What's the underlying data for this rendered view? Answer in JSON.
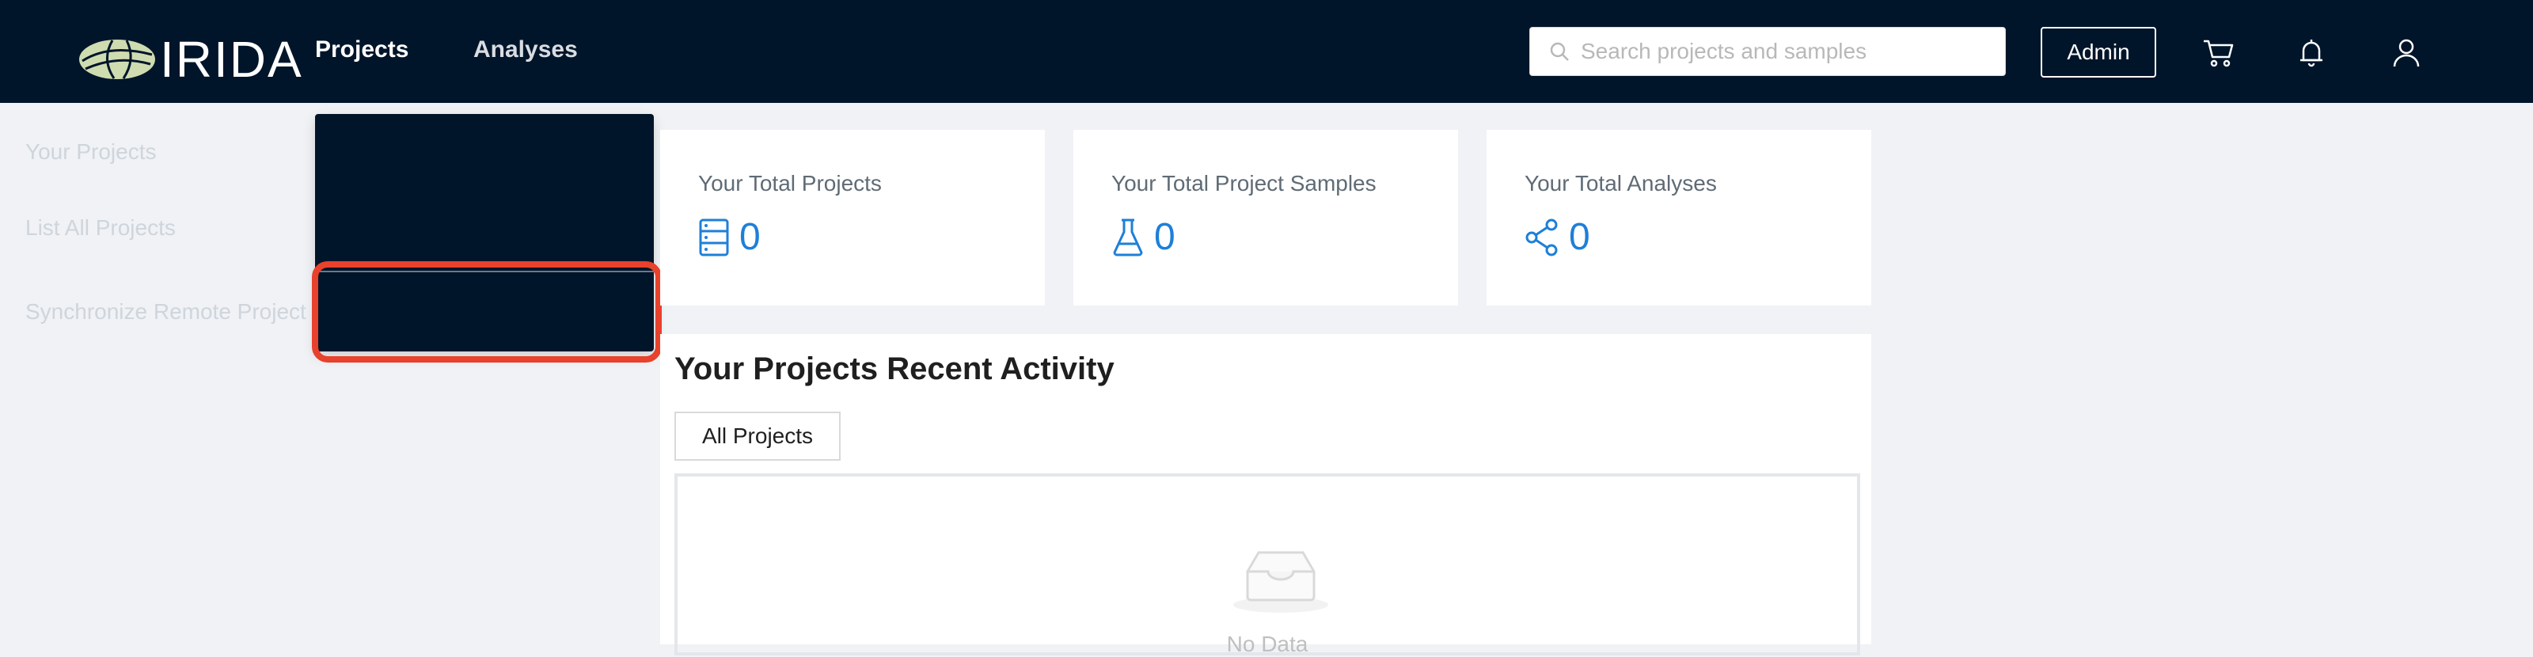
{
  "app": {
    "name": "IRIDA"
  },
  "nav": {
    "projects": "Projects",
    "analyses": "Analyses",
    "search_placeholder": "Search projects and samples",
    "admin": "Admin"
  },
  "dropdown": {
    "items": [
      "Your Projects",
      "List All Projects",
      "Synchronize Remote Project"
    ],
    "highlighted_item": "Synchronize Remote Project"
  },
  "cards": [
    {
      "title": "Your Total Projects",
      "value": "0",
      "icon": "database-icon"
    },
    {
      "title": "Your Total Project Samples",
      "value": "0",
      "icon": "flask-icon"
    },
    {
      "title": "Your Total Analyses",
      "value": "0",
      "icon": "share-icon"
    }
  ],
  "activity": {
    "title": "Your Projects Recent Activity",
    "tab": "All Projects",
    "empty_text": "No Data"
  },
  "colors": {
    "navbar": "#00152a",
    "accent": "#1e7fd8",
    "highlight": "#e8412c",
    "background": "#f0f2f5"
  }
}
